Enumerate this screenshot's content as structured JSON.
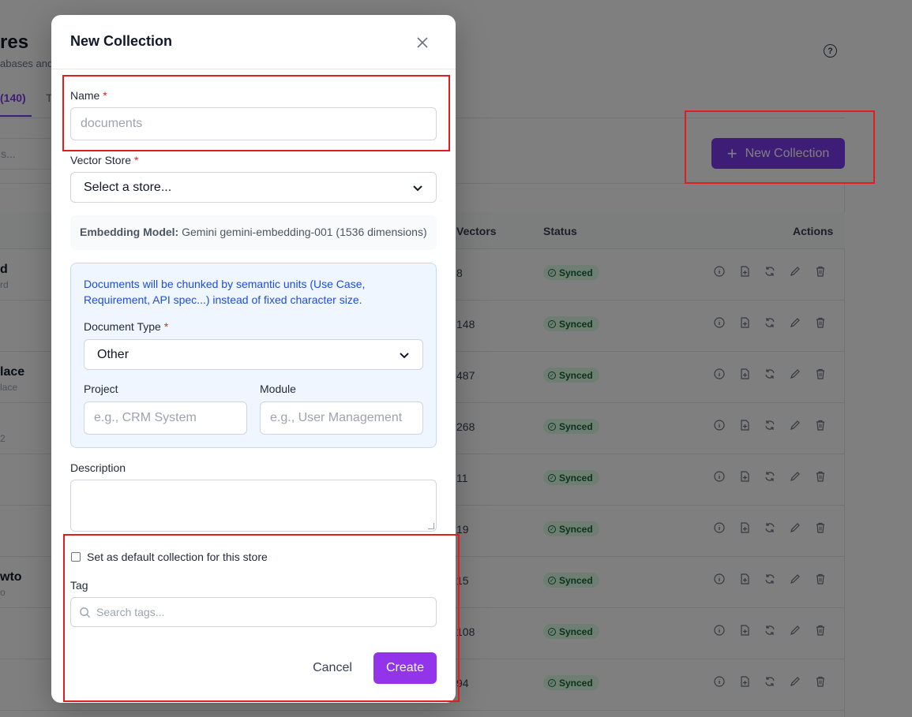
{
  "background": {
    "page_title": "res",
    "page_subtitle": "abases and",
    "help_icon": "question-circle-icon",
    "tab_active": "(140)",
    "tab_other": "T",
    "search_text": "s...",
    "new_collection_button": "New Collection",
    "table_headers": {
      "vectors": "Vectors",
      "status": "Status",
      "actions": "Actions"
    },
    "rows": [
      {
        "name": "d",
        "sub": "rd",
        "vectors": "8",
        "status": "Synced"
      },
      {
        "name": "",
        "sub": "",
        "vectors": "148",
        "status": "Synced"
      },
      {
        "name": "lace",
        "sub": "lace",
        "vectors": "487",
        "status": "Synced"
      },
      {
        "name": "",
        "sub": "2",
        "vectors": "268",
        "status": "Synced"
      },
      {
        "name": "",
        "sub": "",
        "vectors": "11",
        "status": "Synced"
      },
      {
        "name": "",
        "sub": "",
        "vectors": "19",
        "status": "Synced"
      },
      {
        "name": "wto",
        "sub": "o",
        "vectors": "15",
        "status": "Synced"
      },
      {
        "name": "",
        "sub": "",
        "vectors": "108",
        "status": "Synced"
      },
      {
        "name": "",
        "sub": "",
        "vectors": "94",
        "status": "Synced"
      }
    ]
  },
  "modal": {
    "title": "New Collection",
    "name_label": "Name",
    "required_mark": "*",
    "name_placeholder": "documents",
    "vector_store_label": "Vector Store",
    "vector_store_value": "Select a store...",
    "embedding_label": "Embedding Model:",
    "embedding_value": "Gemini gemini-embedding-001 (1536 dimensions)",
    "info_text": "Documents will be chunked by semantic units (Use Case, Requirement, API spec...) instead of fixed character size.",
    "document_type_label": "Document Type",
    "document_type_value": "Other",
    "project_label": "Project",
    "project_placeholder": "e.g., CRM System",
    "module_label": "Module",
    "module_placeholder": "e.g., User Management",
    "description_label": "Description",
    "default_checkbox_label": "Set as default collection for this store",
    "tag_label": "Tag",
    "tag_placeholder": "Search tags...",
    "cancel_label": "Cancel",
    "create_label": "Create"
  },
  "colors": {
    "accent": "#7c3aed",
    "create_button": "#9333ea",
    "required": "#dc2626",
    "info_text": "#1d4ed8",
    "info_bg": "#eff6ff",
    "synced_bg": "#dcfce7",
    "synced_text": "#166534",
    "annotation": "#e11d1d"
  }
}
